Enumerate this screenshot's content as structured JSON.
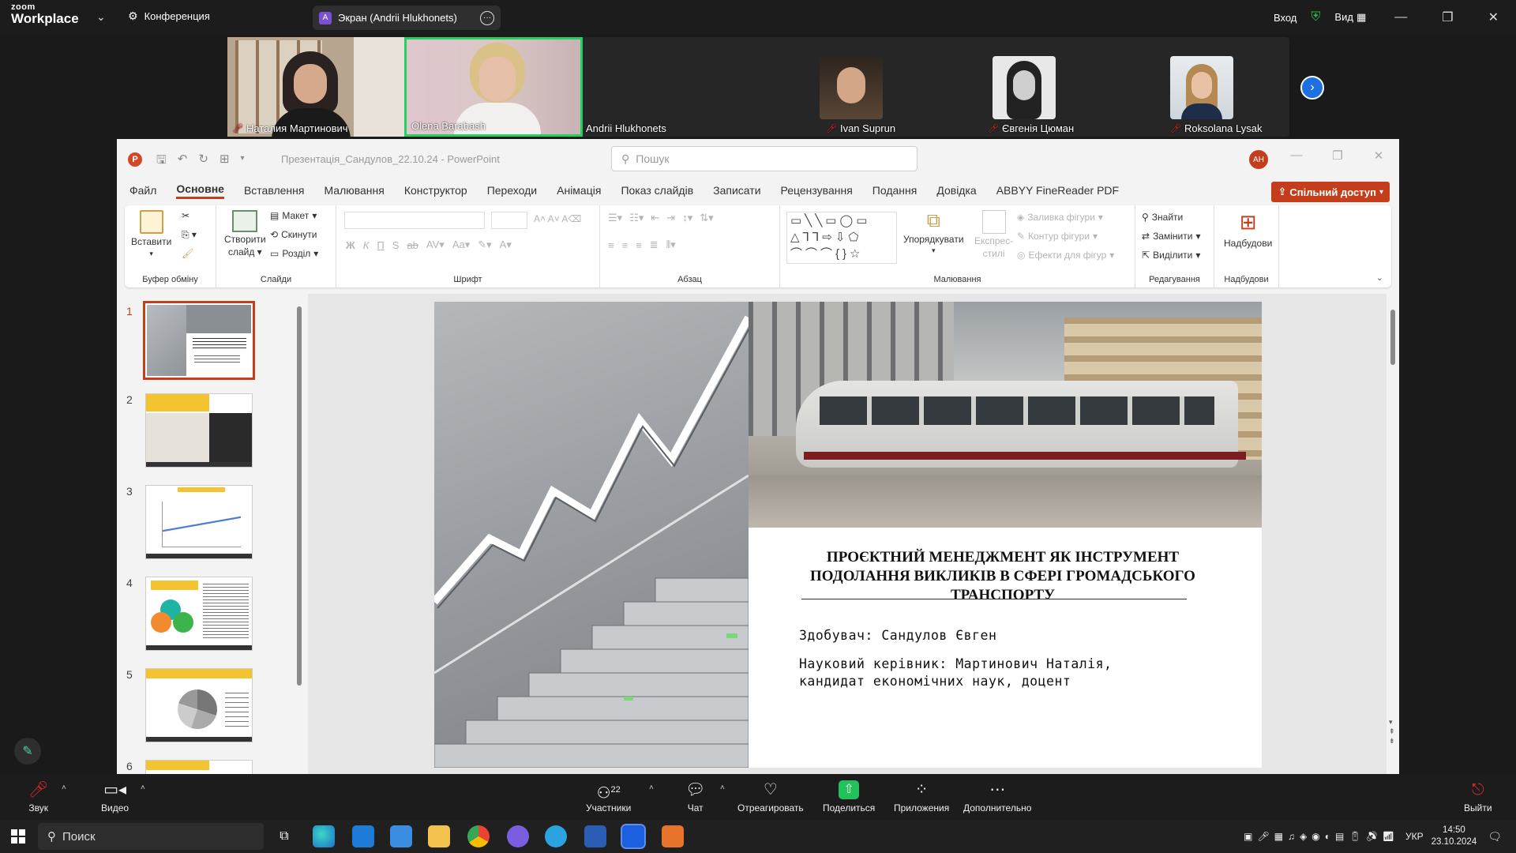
{
  "zoom": {
    "logo_line1": "zoom",
    "logo_line2": "Workplace",
    "conference_label": "Конференция",
    "share_label": "Экран (Andrii Hlukhonets)",
    "share_avatar": "A",
    "login_label": "Вход",
    "view_label": "Вид",
    "participants": [
      {
        "name": "Наталия Мартинович",
        "muted": true
      },
      {
        "name": "Olena Barabash",
        "muted": false,
        "active": true
      },
      {
        "name": "Andrii Hlukhonets",
        "muted": false
      },
      {
        "name": "Ivan Suprun",
        "muted": true
      },
      {
        "name": "Євгенія Цюман",
        "muted": true
      },
      {
        "name": "Roksolana Lysak",
        "muted": true
      }
    ],
    "toolbar": {
      "audio": "Звук",
      "video": "Видео",
      "participants": "Участники",
      "participants_count": "22",
      "chat": "Чат",
      "react": "Отреагировать",
      "share": "Поделиться",
      "apps": "Приложения",
      "more": "Дополнительно",
      "leave": "Выйти"
    }
  },
  "powerpoint": {
    "app_letter": "P",
    "doc_title": "Презентація_Сандулов_22.10.24  -  PowerPoint",
    "search_placeholder": "Пошук",
    "user_initials": "AH",
    "share_button": "Спільний доступ",
    "menu": [
      "Файл",
      "Основне",
      "Вставлення",
      "Малювання",
      "Конструктор",
      "Переходи",
      "Анімація",
      "Показ слайдів",
      "Записати",
      "Рецензування",
      "Подання",
      "Довідка",
      "ABBYY FineReader PDF"
    ],
    "active_menu": "Основне",
    "ribbon": {
      "paste": "Вставити",
      "clipboard": "Буфер обміну",
      "new_slide_1": "Створити",
      "new_slide_2": "слайд",
      "layout": "Макет",
      "reset": "Скинути",
      "section": "Розділ",
      "slides": "Слайди",
      "font": "Шрифт",
      "paragraph": "Абзац",
      "arrange": "Упорядкувати",
      "quick_styles_1": "Експрес-",
      "quick_styles_2": "стилі",
      "shape_fill": "Заливка фігури",
      "shape_outline": "Контур фігури",
      "shape_effects": "Ефекти для фігур",
      "drawing": "Малювання",
      "find": "Знайти",
      "replace": "Замінити",
      "select": "Виділити",
      "editing": "Редагування",
      "addins": "Надбудови",
      "addins_group": "Надбудови"
    },
    "slide_numbers": [
      "1",
      "2",
      "3",
      "4",
      "5",
      "6"
    ],
    "slide": {
      "title": "ПРОЄКТНИЙ МЕНЕДЖМЕНТ ЯК ІНСТРУМЕНТ ПОДОЛАННЯ ВИКЛИКІВ В СФЕРІ ГРОМАДСЬКОГО ТРАНСПОРТУ",
      "author": "Здобувач: Сандулов Євген",
      "advisor_1": "Науковий керівник: Мартинович Наталія,",
      "advisor_2": "кандидат економічних наук, доцент"
    }
  },
  "taskbar": {
    "search": "Поиск",
    "lang": "УКР",
    "time": "14:50",
    "date": "23.10.2024"
  }
}
